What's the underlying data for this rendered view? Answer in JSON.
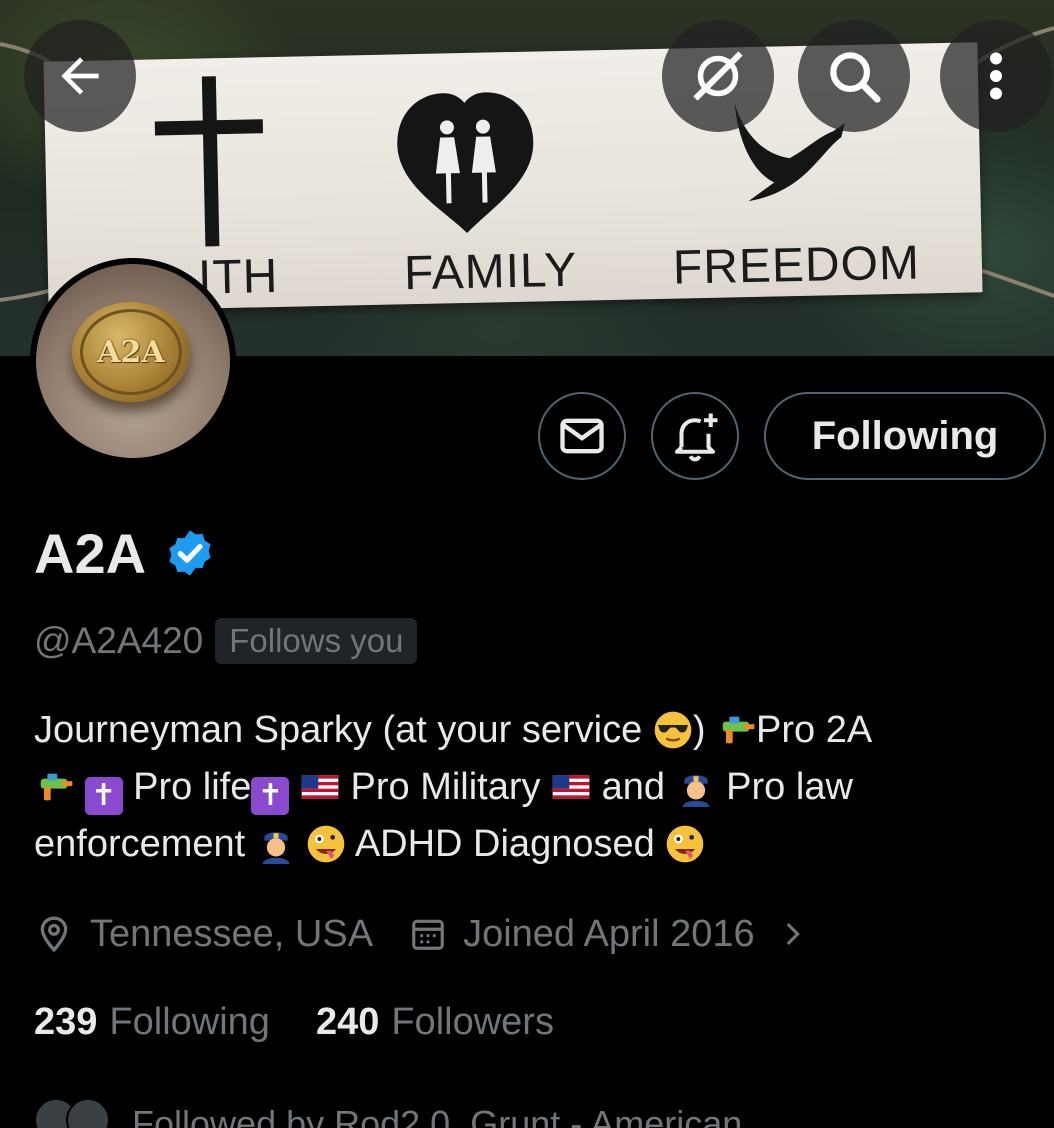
{
  "banner": {
    "words": [
      "FAITH",
      "FAMILY",
      "FREEDOM"
    ],
    "visible_faith": "ITH",
    "icons": [
      "cross",
      "heart-with-two-women",
      "dove"
    ]
  },
  "toolbar": {
    "back_icon": "arrow-left-icon",
    "grok_icon": "grok-icon",
    "search_icon": "search-icon",
    "more_icon": "more-vertical-icon"
  },
  "avatar": {
    "coin_text": "A2A",
    "alt": "A2A coin"
  },
  "actions": {
    "message_icon": "envelope-icon",
    "notify_icon": "bell-plus-icon",
    "following_label": "Following"
  },
  "profile": {
    "name": "A2A",
    "verified": true,
    "handle": "@A2A420",
    "follows_you": "Follows you",
    "bio": {
      "p1": "Journeyman Sparky (at your service ",
      "p2": ") ",
      "p3": "Pro 2A",
      "p4": " ",
      "p5": " Pro life",
      "p6": " ",
      "p7": " Pro Military ",
      "p8": " and ",
      "p9": " Pro law enforcement ",
      "p10": " ",
      "p11": " ADHD Diagnosed ",
      "cross_glyph": "✝"
    },
    "location": "Tennessee, USA",
    "joined": "Joined April 2016",
    "following_count": "239",
    "following_label": "Following",
    "followers_count": "240",
    "followers_label": "Followers",
    "followed_by": "Followed by Rod2.0, Grunt - American"
  },
  "colors": {
    "background": "#000000",
    "text": "#e7e9ea",
    "secondary": "#71767b",
    "border": "#536471",
    "verified": "#1d9bf0"
  }
}
